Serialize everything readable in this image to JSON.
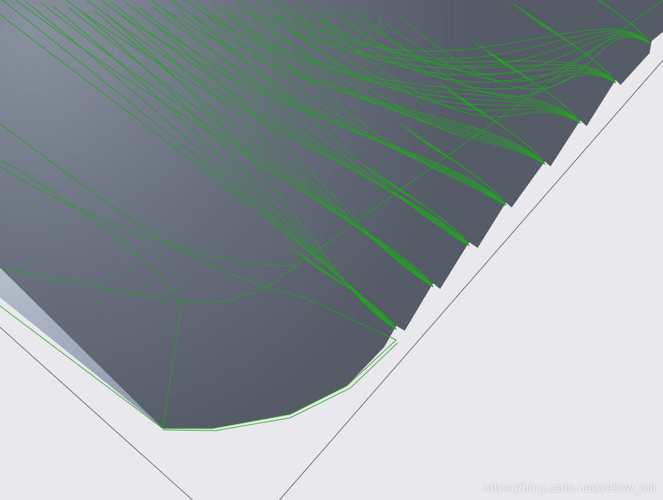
{
  "viewport": {
    "background_color": "#e9e9ed",
    "model_color": "#565c68",
    "model_highlight_color": "#7d8594",
    "side_face_color": "#a6b0c0",
    "edge_color": "#22a322",
    "guide_line_color": "#5e5460"
  },
  "watermark": {
    "text": "https://blog.csdn.net/yellow_hill"
  }
}
